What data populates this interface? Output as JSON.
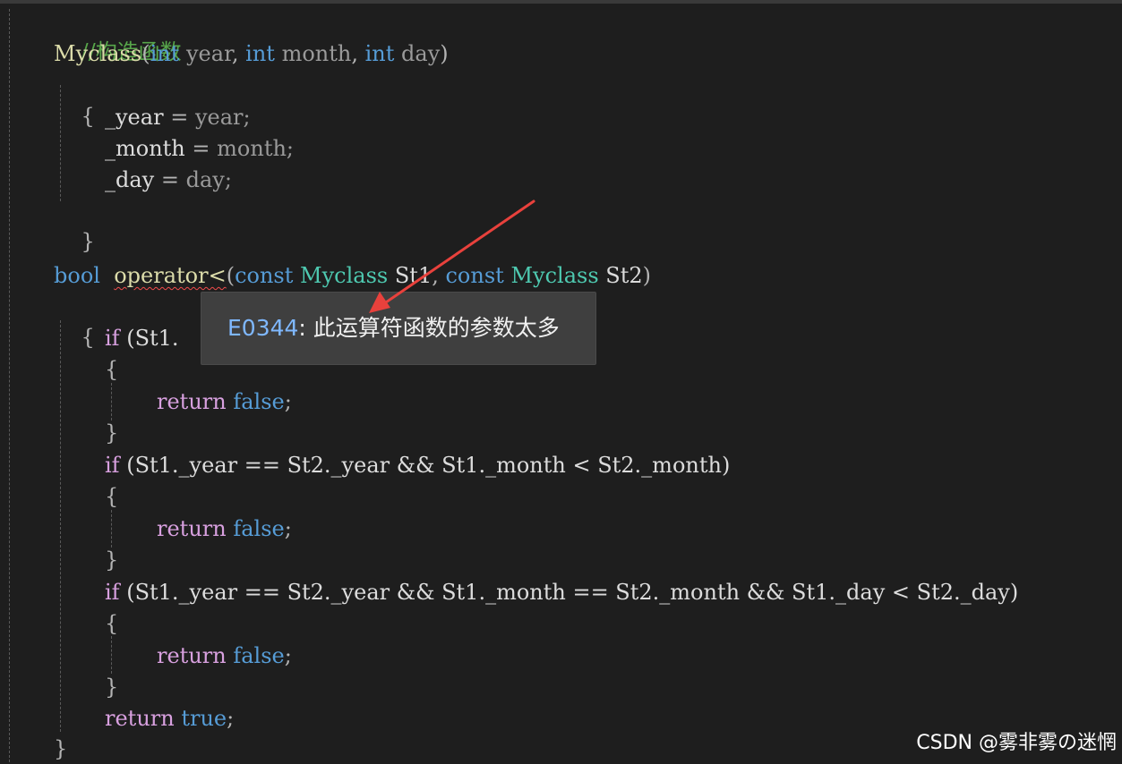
{
  "code": {
    "comment": "//构造函数",
    "ctor_name": "Myclass",
    "ctor_params": [
      "int",
      "year",
      "int",
      "month",
      "int",
      "day"
    ],
    "open_brace": "{",
    "close_brace": "}",
    "assign_year": [
      "_year",
      "=",
      "year;"
    ],
    "assign_month": [
      "_month",
      "=",
      "month;"
    ],
    "assign_day": [
      "_day",
      "=",
      "day;"
    ],
    "op_return_type": "bool",
    "op_name": "operator<",
    "op_params": [
      "const",
      "Myclass",
      "St1",
      "const",
      "Myclass",
      "St2"
    ],
    "if_kw": "if",
    "if1_partial": "(St1.",
    "if2_cond": "(St1._year == St2._year && St1._month < St2._month)",
    "if3_cond": "(St1._year == St2._year && St1._month == St2._month && St1._day < St2._day)",
    "return_kw": "return",
    "false_kw": "false",
    "true_kw": "true",
    "semicolon": ";"
  },
  "tooltip": {
    "code": "E0344",
    "message": ": 此运算符函数的参数太多"
  },
  "colors": {
    "background": "#1e1e1e",
    "arrow": "#e8413c",
    "squiggle": "#f14c4c"
  },
  "watermark": "CSDN @雾非雾の迷惘"
}
